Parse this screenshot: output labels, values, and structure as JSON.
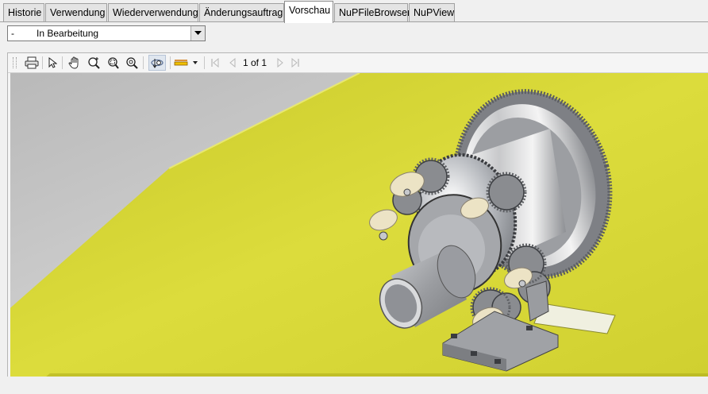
{
  "tabs": [
    {
      "label": "Historie",
      "active": false
    },
    {
      "label": "Verwendung",
      "active": false
    },
    {
      "label": "Wiederverwendung",
      "active": false
    },
    {
      "label": "Änderungsauftrag",
      "active": false
    },
    {
      "label": "Vorschau",
      "active": true
    },
    {
      "label": "NuPFileBrowser",
      "active": false
    },
    {
      "label": "NuPView",
      "active": false
    }
  ],
  "status_dropdown": {
    "prefix": "-",
    "value": "In Bearbeitung"
  },
  "viewer": {
    "toolbar_tools": [
      "print-icon",
      "select-arrow-icon",
      "pan-hand-icon",
      "zoom-in-icon",
      "zoom-window-icon",
      "zoom-fit-icon",
      "orbit-icon",
      "measure-icon",
      "first-page-icon",
      "previous-page-icon",
      "next-page-icon",
      "last-page-icon"
    ],
    "page_indicator": "1 of 1"
  },
  "colors": {
    "plate": "#d6d630",
    "plate_edge": "#a8a818",
    "background": "#c2c2c2",
    "metal": "#9ea1a6"
  }
}
